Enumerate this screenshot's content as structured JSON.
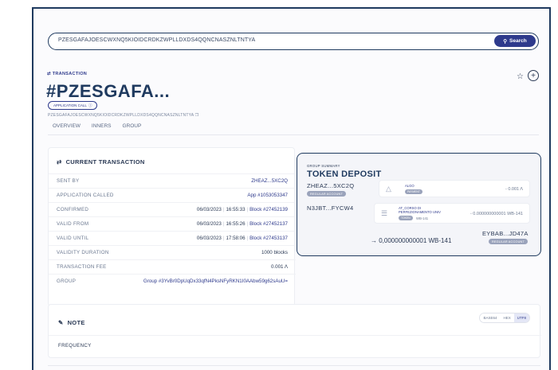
{
  "search": {
    "query": "PZESGAFAJOESCWXNQ5KIOIDCRDKZWPLLDXDS4QQNCNASZNLTNTYA",
    "button_label": "Search"
  },
  "header": {
    "kicker": "TRANSACTION",
    "title": "#PZESGAFA...",
    "type_badge": "APPLICATION CALL",
    "full_id": "PZESGAFAJOESCWXNQ5KIOIDCRDKZWPLLDXDS4QQNCNASZNLTNTYA",
    "tabs": [
      "OVERVIEW",
      "INNERS",
      "GROUP"
    ]
  },
  "current": {
    "heading": "CURRENT TRANSACTION",
    "sent_by_label": "SENT BY",
    "sent_by": "ZHEAZ...5XC2Q",
    "app_called_label": "APPLICATION CALLED",
    "app_called": "App #1053053347",
    "confirmed_label": "CONFIRMED",
    "confirmed_date": "06/03/2023",
    "confirmed_time": "16:55:33",
    "confirmed_block": "Block #27452139",
    "valid_from_label": "VALID FROM",
    "valid_from_date": "06/03/2023",
    "valid_from_time": "16:55:26",
    "valid_from_block": "Block #27452137",
    "valid_until_label": "VALID UNTIL",
    "valid_until_date": "06/03/2023",
    "valid_until_time": "17:58:06",
    "valid_until_block": "Block #27453137",
    "validity_label": "VALIDITY DURATION",
    "validity": "1000 blocks",
    "fee_label": "TRANSACTION FEE",
    "fee": "0.001",
    "group_label": "GROUP",
    "group": "Group #3YvBr0DpUqDx33qfN4PksNFyRKN1I0AAbw59g62sAuU="
  },
  "group_summary": {
    "kicker": "GROUP SUMMARY",
    "title": "TOKEN DEPOSIT",
    "account1": "ZHEAZ...5XC2Q",
    "account1_badge": "REGULAR ACCOUNT",
    "asset1_name": "ALGO",
    "asset1_badge": "PAYMENT",
    "asset1_amount": "- 0.001",
    "account2": "N3JBT...FYCW4",
    "asset2_name_l1": "AT_CORSO DI",
    "asset2_name_l2": "PERFEZIONAMENTO UNIV",
    "asset2_badge": "TOKEN",
    "asset2_unit": "WB-141",
    "asset2_amount": "- 0.000000000001 WB-141",
    "big_amount": "→ 0,000000000001 WB-141",
    "account3": "EYBAB...JD47A",
    "account3_badge": "REGULAR ACCOUNT"
  },
  "note": {
    "heading": "NOTE",
    "label": "FREQUENCY",
    "encodings": [
      "BASE64",
      "HEX",
      "UTF8"
    ],
    "active_encoding": "UTF8"
  }
}
